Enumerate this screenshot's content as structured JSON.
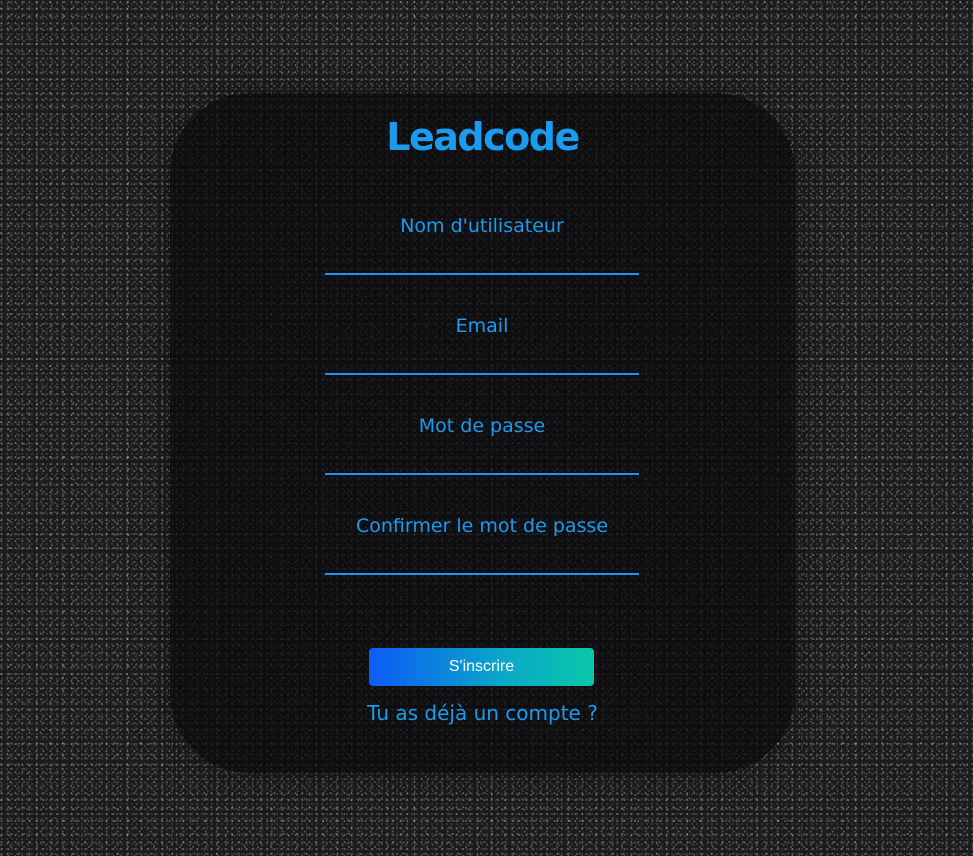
{
  "app": {
    "title": "Leadcode"
  },
  "form": {
    "fields": [
      {
        "label": "Nom d'utilisateur",
        "value": "",
        "placeholder": ""
      },
      {
        "label": "Email",
        "value": "",
        "placeholder": ""
      },
      {
        "label": "Mot de passe",
        "value": "",
        "placeholder": ""
      },
      {
        "label": "Confirmer le mot de passe",
        "value": "",
        "placeholder": ""
      }
    ],
    "submit_label": "S'inscrire",
    "login_link": "Tu as déjà un compte ?"
  },
  "colors": {
    "accent": "#1b9bf0",
    "button_gradient_start": "#0d5cf6",
    "button_gradient_end": "#0ac7aa",
    "card_background": "#0a0a0c",
    "page_background": "#1c1c1d"
  }
}
